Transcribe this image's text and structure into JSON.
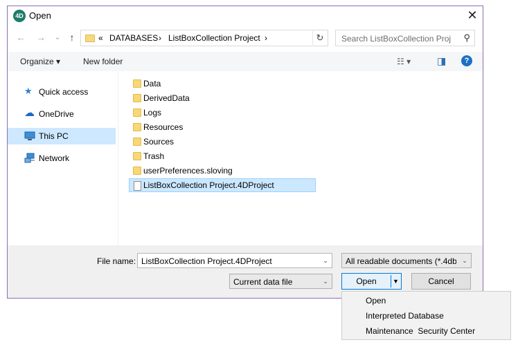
{
  "window": {
    "title": "Open",
    "app_logo": "4D",
    "close_glyph": "✕"
  },
  "nav": {
    "back_glyph": "←",
    "forward_glyph": "→",
    "recent_glyph": "⌄",
    "up_glyph": "↑"
  },
  "address": {
    "overflow": "«",
    "crumbs": [
      "DATABASES",
      "ListBoxCollection Project"
    ],
    "sep": "›",
    "refresh_glyph": "↻"
  },
  "search": {
    "placeholder": "Search ListBoxCollection Proj",
    "icon_glyph": "⚲"
  },
  "toolbar": {
    "organize": "Organize ▾",
    "new_folder": "New folder",
    "view_glyph": "☷ ▾",
    "pane_glyph": "◨",
    "help_glyph": "?"
  },
  "sidebar": {
    "items": [
      {
        "label": "Quick access",
        "icon": "star-icon",
        "glyph": "★"
      },
      {
        "label": "OneDrive",
        "icon": "cloud-icon",
        "glyph": "☁"
      },
      {
        "label": "This PC",
        "icon": "computer-icon",
        "glyph": ""
      },
      {
        "label": "Network",
        "icon": "network-icon",
        "glyph": ""
      }
    ],
    "selected": "This PC"
  },
  "files": [
    {
      "name": "Data",
      "type": "folder"
    },
    {
      "name": "DerivedData",
      "type": "folder"
    },
    {
      "name": "Logs",
      "type": "folder"
    },
    {
      "name": "Resources",
      "type": "folder"
    },
    {
      "name": "Sources",
      "type": "folder"
    },
    {
      "name": "Trash",
      "type": "folder"
    },
    {
      "name": "userPreferences.sloving",
      "type": "folder"
    },
    {
      "name": "ListBoxCollection Project.4DProject",
      "type": "file",
      "selected": true
    }
  ],
  "bottom": {
    "file_name_label": "File name:",
    "file_name_value": "ListBoxCollection Project.4DProject",
    "file_type": "All readable documents (*.4db;",
    "data_file": "Current data file",
    "open_label": "Open",
    "cancel_label": "Cancel",
    "arrow_glyph": "▼"
  },
  "open_menu": {
    "items": [
      "Open",
      "Interpreted Database",
      "Maintenance  Security Center"
    ]
  },
  "colors": {
    "accent": "#0078d7",
    "selection": "#cce8ff",
    "folder": "#f8d775"
  }
}
